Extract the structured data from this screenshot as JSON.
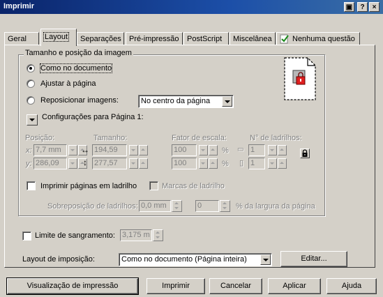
{
  "window": {
    "title": "Imprimir"
  },
  "tabs": [
    {
      "label": "Geral"
    },
    {
      "label": "Layout"
    },
    {
      "label": "Separações"
    },
    {
      "label": "Pré-impressão"
    },
    {
      "label": "PostScript"
    },
    {
      "label": "Miscelânea"
    },
    {
      "label": "Nenhuma questão"
    }
  ],
  "active_tab": "Layout",
  "group": {
    "title": "Tamanho e posição da imagem",
    "radio_as_document": "Como no documento",
    "radio_fit_page": "Ajustar à página",
    "radio_reposition": "Reposicionar imagens:",
    "reposition_value": "No centro da página",
    "selected_radio": "Como no documento",
    "config_label": "Configurações para Página 1:"
  },
  "grid": {
    "position_header": "Posição:",
    "size_header": "Tamanho:",
    "scale_header": "Fator de escala:",
    "tiles_header": "N° de ladrilhos:",
    "x_label": "x:",
    "y_label": "y:",
    "x_value": "7,7 mm",
    "y_value": "286,09",
    "width_value": "194,59",
    "height_value": "277,57",
    "scale_x": "100",
    "scale_y": "100",
    "percent": "%",
    "tiles_x": "1",
    "tiles_y": "1"
  },
  "tiling": {
    "tile_label": "Imprimir páginas em ladrilho",
    "tile_checked": false,
    "marks_label": "Marcas de ladrilho",
    "overlap_label": "Sobreposição de ladrilhos:",
    "overlap_value": "0,0 mm",
    "overlap_percent": "0",
    "overlap_suffix": "% da largura da página"
  },
  "bleed": {
    "label": "Limite de sangramento:",
    "checked": false,
    "value": "3,175 m"
  },
  "imposition": {
    "label": "Layout de imposição:",
    "value": "Como no documento (Página inteira)",
    "edit_button": "Editar..."
  },
  "footer": {
    "preview": "Visualização de impressão",
    "print": "Imprimir",
    "cancel": "Cancelar",
    "apply": "Aplicar",
    "help": "Ajuda"
  },
  "colors": {
    "title_bar": "#0a246a",
    "surface": "#d4d0c8",
    "backdrop": "#f5c400",
    "lock_red": "#e02020"
  }
}
